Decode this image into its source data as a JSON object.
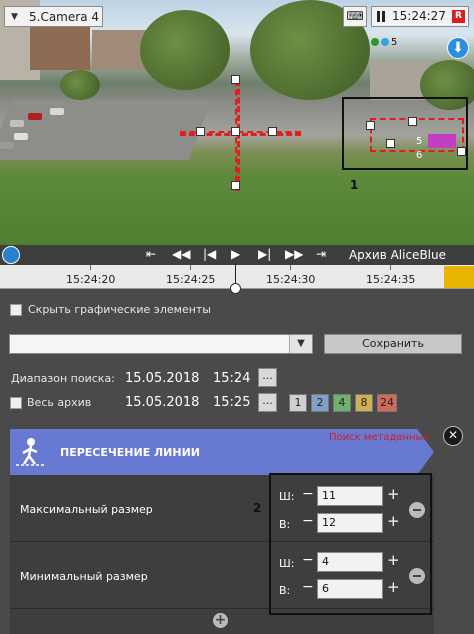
{
  "camera": {
    "title": "5.Camera 4",
    "time": "15:24:27",
    "rec_badge": "R",
    "keyboard_icon": "keyboard-icon"
  },
  "overlay": {
    "detector_dots_label": "5",
    "zone_label_1": "1",
    "zone_label_2": "2",
    "object_tags": [
      "5",
      "6",
      "5"
    ]
  },
  "playback": {
    "archive_label": "Архив AliceBlue"
  },
  "timeline": {
    "labels": [
      "15:24:20",
      "15:24:25",
      "15:24:30",
      "15:24:35"
    ]
  },
  "controls": {
    "hide_graphics_label": "Скрыть графические элементы",
    "save_label": "Сохранить",
    "search_range_label": "Диапазон поиска:",
    "range_from_date": "15.05.2018",
    "range_from_time": "15:24",
    "whole_archive_label": "Весь архив",
    "range_to_date": "15.05.2018",
    "range_to_time": "15:25",
    "dots": "...",
    "range_buttons": [
      {
        "label": "1",
        "color": "#cfcfcf"
      },
      {
        "label": "2",
        "color": "#7fa0c8"
      },
      {
        "label": "4",
        "color": "#6fb26f"
      },
      {
        "label": "8",
        "color": "#d0b050"
      },
      {
        "label": "24",
        "color": "#d06a5a"
      }
    ]
  },
  "detector": {
    "title": "ПЕРЕСЕЧЕНИЕ ЛИНИИ",
    "metadata_link": "Поиск метаданных",
    "max_label": "Максимальный размер",
    "min_label": "Минимальный размер",
    "w_label": "Ш:",
    "h_label": "В:",
    "max_w": "11",
    "max_h": "12",
    "min_w": "4",
    "min_h": "6"
  },
  "colors": {
    "header": "#6879d2",
    "accent_red": "#d42020",
    "timeline_corner": "#e8b400"
  }
}
